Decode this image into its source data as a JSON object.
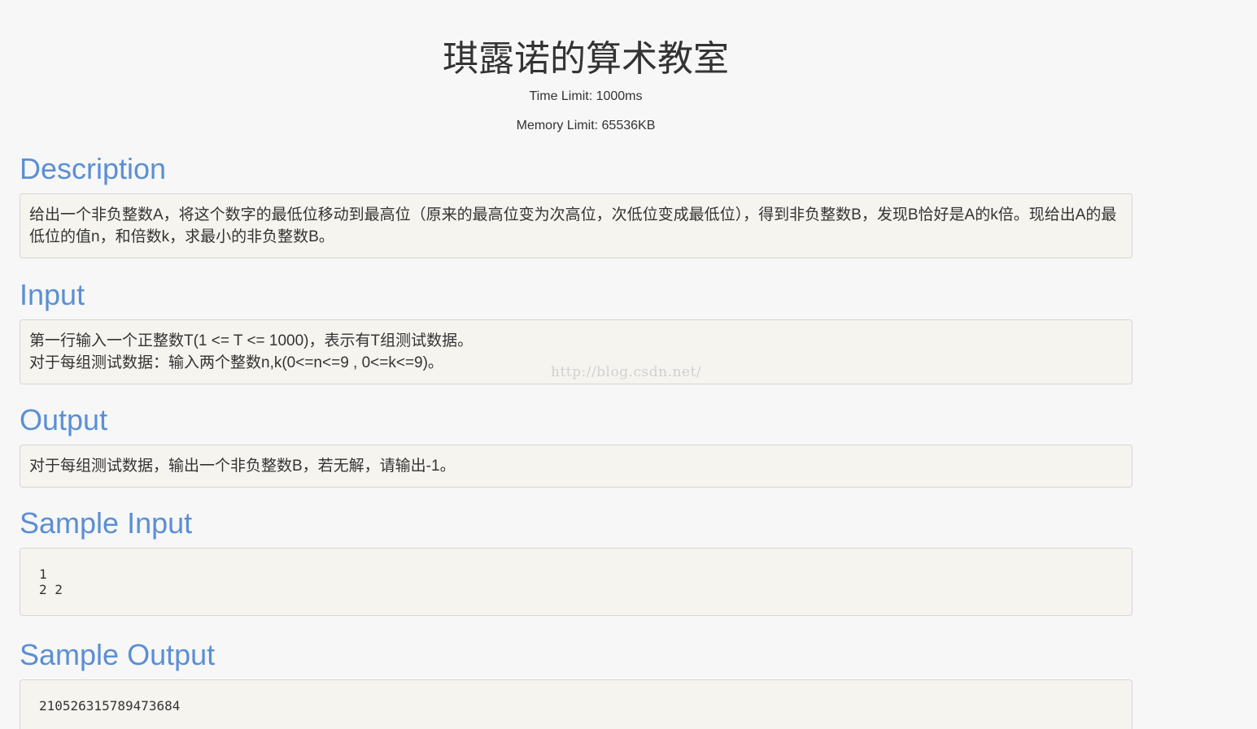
{
  "problem": {
    "title": "琪露诺的算术教室",
    "time_limit": "Time Limit: 1000ms",
    "memory_limit": "Memory Limit: 65536KB"
  },
  "description": {
    "heading": "Description",
    "text": "给出一个非负整数A，将这个数字的最低位移动到最高位（原来的最高位变为次高位，次低位变成最低位），得到非负整数B，发现B恰好是A的k倍。现给出A的最低位的值n，和倍数k，求最小的非负整数B。"
  },
  "input": {
    "heading": "Input",
    "lines": [
      "第一行输入一个正整数T(1 <= T <= 1000)，表示有T组测试数据。",
      "对于每组测试数据：输入两个整数n,k(0<=n<=9 , 0<=k<=9)。"
    ]
  },
  "output": {
    "heading": "Output",
    "text": "对于每组测试数据，输出一个非负整数B，若无解，请输出-1。"
  },
  "sample_input": {
    "heading": "Sample Input",
    "text": "1\n2 2"
  },
  "sample_output": {
    "heading": "Sample Output",
    "text": "210526315789473684"
  },
  "watermark": "http://blog.csdn.net/"
}
